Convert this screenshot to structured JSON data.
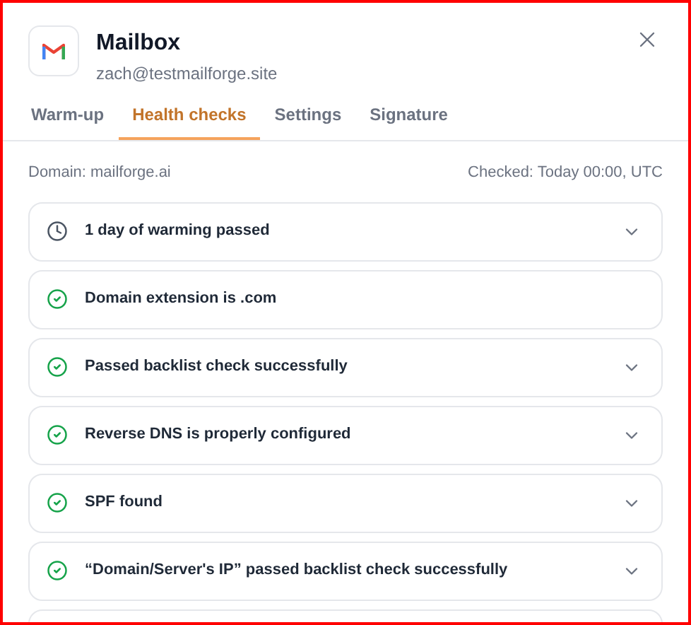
{
  "header": {
    "title": "Mailbox",
    "email": "zach@testmailforge.site"
  },
  "tabs": [
    {
      "label": "Warm-up",
      "selected": false
    },
    {
      "label": "Health checks",
      "selected": true
    },
    {
      "label": "Settings",
      "selected": false
    },
    {
      "label": "Signature",
      "selected": false
    }
  ],
  "summary": {
    "domain": "Domain: mailforge.ai",
    "checked": "Checked: Today 00:00, UTC"
  },
  "checks": [
    {
      "kind": "clock",
      "label": "1 day of warming passed",
      "expandable": true
    },
    {
      "kind": "check",
      "label": "Domain extension is .com",
      "expandable": false
    },
    {
      "kind": "check",
      "label": "Passed backlist check successfully",
      "expandable": true
    },
    {
      "kind": "check",
      "label": "Reverse DNS is properly configured",
      "expandable": true
    },
    {
      "kind": "check",
      "label": "SPF found",
      "expandable": true
    },
    {
      "kind": "check",
      "label": "“Domain/Server's IP” passed backlist check successfully",
      "expandable": true
    }
  ]
}
